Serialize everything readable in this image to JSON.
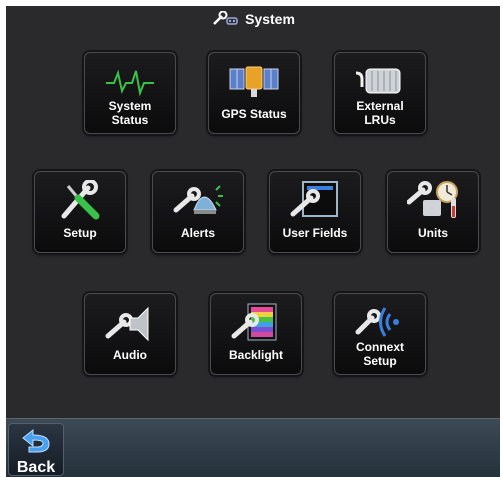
{
  "page": {
    "title": "System"
  },
  "tiles": [
    {
      "label": "System\nStatus",
      "icon": "waveform-icon"
    },
    {
      "label": "GPS Status",
      "icon": "satellite-icon"
    },
    {
      "label": "External\nLRUs",
      "icon": "lru-connector-icon"
    },
    {
      "label": "Setup",
      "icon": "wrench-screwdriver-icon"
    },
    {
      "label": "Alerts",
      "icon": "alert-icon"
    },
    {
      "label": "User Fields",
      "icon": "user-fields-icon"
    },
    {
      "label": "Units",
      "icon": "units-icon"
    },
    {
      "label": "Audio",
      "icon": "speaker-icon"
    },
    {
      "label": "Backlight",
      "icon": "backlight-icon"
    },
    {
      "label": "Connext\nSetup",
      "icon": "connext-icon"
    }
  ],
  "footer": {
    "back_label": "Back"
  },
  "colors": {
    "background": "#2a2a2c",
    "tile": "#111113",
    "bar": "#2f3b46",
    "accent_green": "#3ac14a",
    "accent_blue": "#3a7fe0"
  }
}
